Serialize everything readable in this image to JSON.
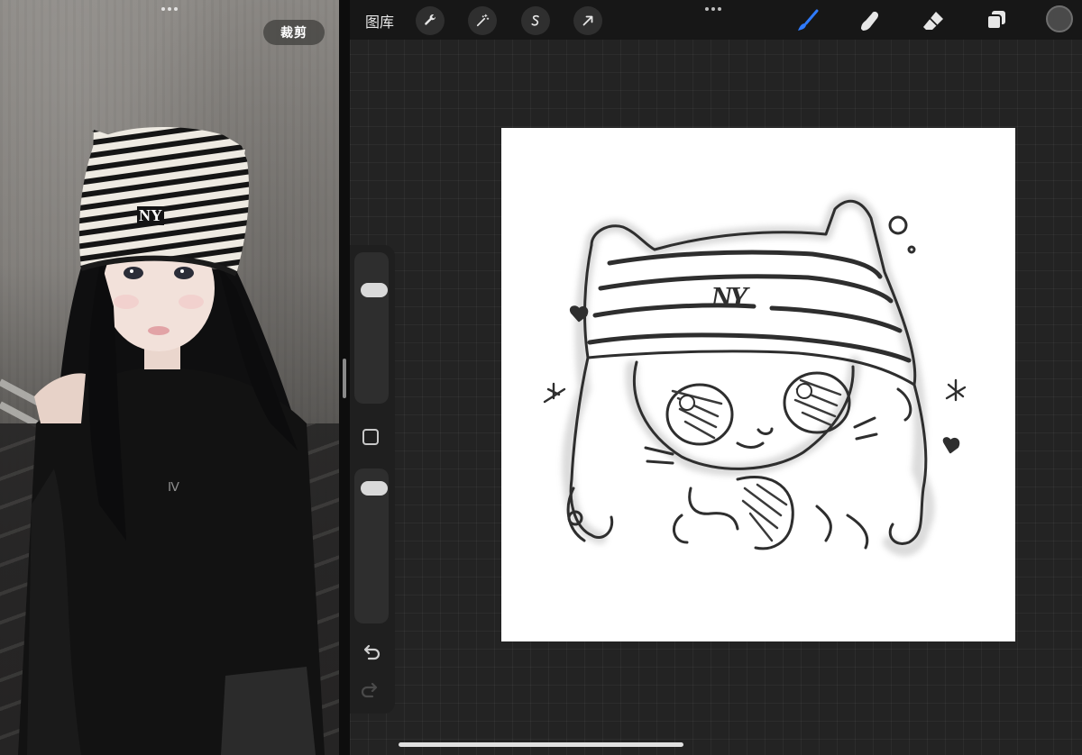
{
  "left_pane": {
    "crop_button_label": "裁剪",
    "hat_logo_text": "NY"
  },
  "toolbar": {
    "gallery_label": "图库",
    "tools_left": [
      {
        "name": "actions",
        "icon": "wrench-icon"
      },
      {
        "name": "adjustments",
        "icon": "magic-wand-icon"
      },
      {
        "name": "selection",
        "icon": "selection-s-icon"
      },
      {
        "name": "transform",
        "icon": "arrow-cursor-icon"
      }
    ],
    "tools_right": [
      {
        "name": "brush",
        "icon": "brush-icon",
        "active": true
      },
      {
        "name": "smudge",
        "icon": "smudge-finger-icon",
        "active": false
      },
      {
        "name": "eraser",
        "icon": "eraser-icon",
        "active": false
      },
      {
        "name": "layers",
        "icon": "layers-icon",
        "active": false
      }
    ],
    "current_color": "#4a4a4a",
    "active_color": "#2f7bff"
  },
  "sidebar": {
    "brush_size_level": 0.79,
    "opacity_level": 0.93,
    "undo_icon": "undo-icon",
    "redo_icon": "redo-icon"
  },
  "canvas": {
    "background": "#ffffff",
    "hat_logo_text": "NY"
  }
}
